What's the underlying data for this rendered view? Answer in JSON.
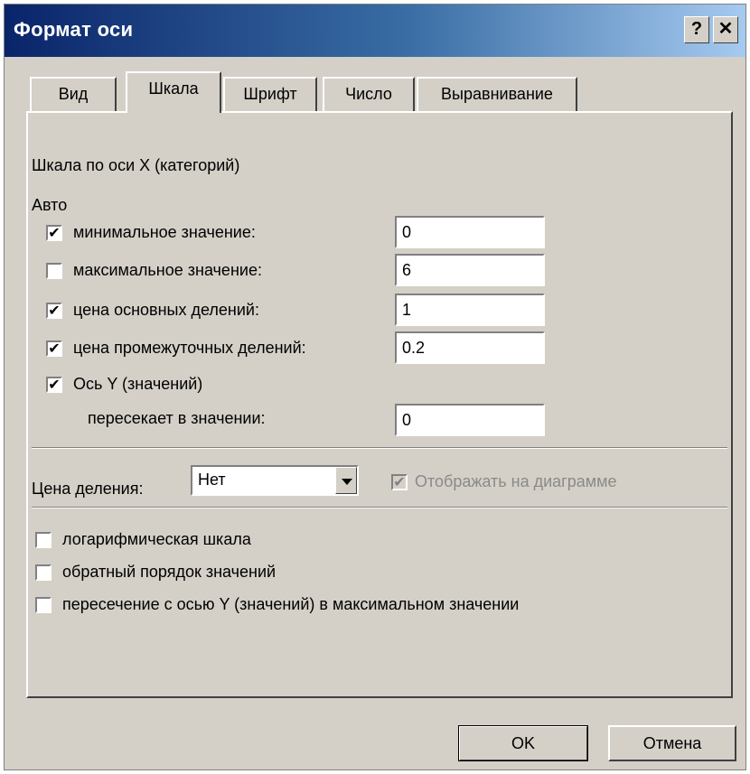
{
  "dialog": {
    "title": "Формат оси",
    "help_label": "?",
    "close_label": "✕"
  },
  "tabs": [
    {
      "label": "Вид"
    },
    {
      "label": "Шкала"
    },
    {
      "label": "Шрифт"
    },
    {
      "label": "Число"
    },
    {
      "label": "Выравнивание"
    }
  ],
  "active_tab": "Шкала",
  "panel": {
    "heading": "Шкала по оси X (категорий)",
    "auto_label": "Авто",
    "rows": [
      {
        "label": "минимальное значение:",
        "checked": true,
        "value": "0"
      },
      {
        "label": "максимальное значение:",
        "checked": false,
        "value": "6"
      },
      {
        "label": "цена основных делений:",
        "checked": true,
        "value": "1"
      },
      {
        "label": "цена промежуточных делений:",
        "checked": true,
        "value": "0.2"
      }
    ],
    "y_axis": {
      "label": "Ось Y (значений)",
      "checked": true
    },
    "crosses_at": {
      "label": "пересекает в значении:",
      "value": "0"
    },
    "division": {
      "label": "Цена деления:",
      "selected": "Нет",
      "show_on_chart": {
        "label": "Отображать на диаграмме",
        "checked": true,
        "disabled": true
      }
    },
    "options": [
      {
        "label": "логарифмическая шкала",
        "checked": false
      },
      {
        "label": "обратный порядок значений",
        "checked": false
      },
      {
        "label": "пересечение с осью Y (значений) в максимальном значении",
        "checked": false
      }
    ]
  },
  "buttons": {
    "ok_label": "OK",
    "cancel_label": "Отмена"
  }
}
